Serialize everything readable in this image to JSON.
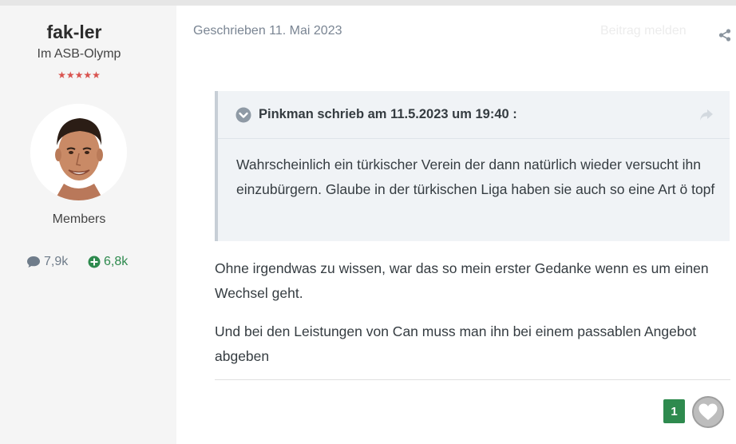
{
  "author": {
    "username": "fak-ler",
    "rank": "Im ASB-Olymp",
    "stars": "★★★★★",
    "group": "Members",
    "posts_count": "7,9k",
    "reputation": "6,8k"
  },
  "post": {
    "date": "Geschrieben 11. Mai 2023",
    "report_label": "Beitrag melden",
    "quote": {
      "citation": "Pinkman schrieb am 11.5.2023 um 19:40 :",
      "text": "Wahrscheinlich ein türkischer Verein der dann natürlich wieder versucht ihn einzubürgern. Glaube in der türkischen Liga haben sie auch so eine Art ö topf"
    },
    "paragraphs": [
      "Ohne irgendwas zu wissen, war das so mein erster Gedanke wenn es um einen Wechsel geht.",
      "Und bei den Leistungen von Can muss man ihn bei einem passablen Angebot abgeben"
    ],
    "reaction_count": "1"
  },
  "icons": {
    "posts": "comment-icon",
    "reputation": "plus-circle-icon",
    "share": "share-icon",
    "quote_toggle": "chevron-down-circle-icon",
    "quote_goto": "arrow-share-icon",
    "like": "heart-icon"
  },
  "colors": {
    "reputation_green": "#2e8a4e",
    "star_red": "#d9534f",
    "quote_bg": "#f0f3f6"
  }
}
